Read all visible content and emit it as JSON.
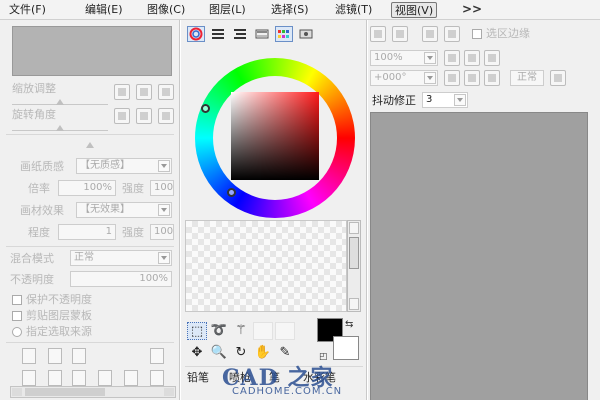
{
  "menu": {
    "items": [
      {
        "label": "文件(F)"
      },
      {
        "label": "编辑(E)"
      },
      {
        "label": "图像(C)"
      },
      {
        "label": "图层(L)"
      },
      {
        "label": "选择(S)"
      },
      {
        "label": "滤镜(T)"
      },
      {
        "label": "视图(V)"
      }
    ],
    "more": ">>"
  },
  "left_panel": {
    "zoom_label": "缩放调整",
    "rotate_label": "旋转角度",
    "paper_texture_label": "画纸质感",
    "paper_texture_value": "【无质感】",
    "scale_label": "倍率",
    "scale_value": "100%",
    "strength_label": "强度",
    "strength_value": "100",
    "material_effect_label": "画材效果",
    "material_effect_value": "【无效果】",
    "degree_label": "程度",
    "degree_value": "1",
    "strength2_label": "强度",
    "strength2_value": "100",
    "blend_mode_label": "混合模式",
    "blend_mode_value": "正常",
    "opacity_label": "不透明度",
    "opacity_value": "100%",
    "protect_opacity": "保护不透明度",
    "clipping_group": "剪贴图层蒙板",
    "selection_source": "指定选取来源"
  },
  "right_panel": {
    "selection_edge": "选区边缘",
    "zoom_value": "100%",
    "angle_value": "+000°",
    "mode_value": "正常",
    "stabilizer_label": "抖动修正",
    "stabilizer_value": "3"
  },
  "tools": {
    "brush_tabs": [
      "铅笔",
      "喷枪",
      "笔",
      "水彩笔"
    ]
  },
  "watermark": {
    "logo": "CAD 之家",
    "url": "CADHOME.COM.CN"
  }
}
